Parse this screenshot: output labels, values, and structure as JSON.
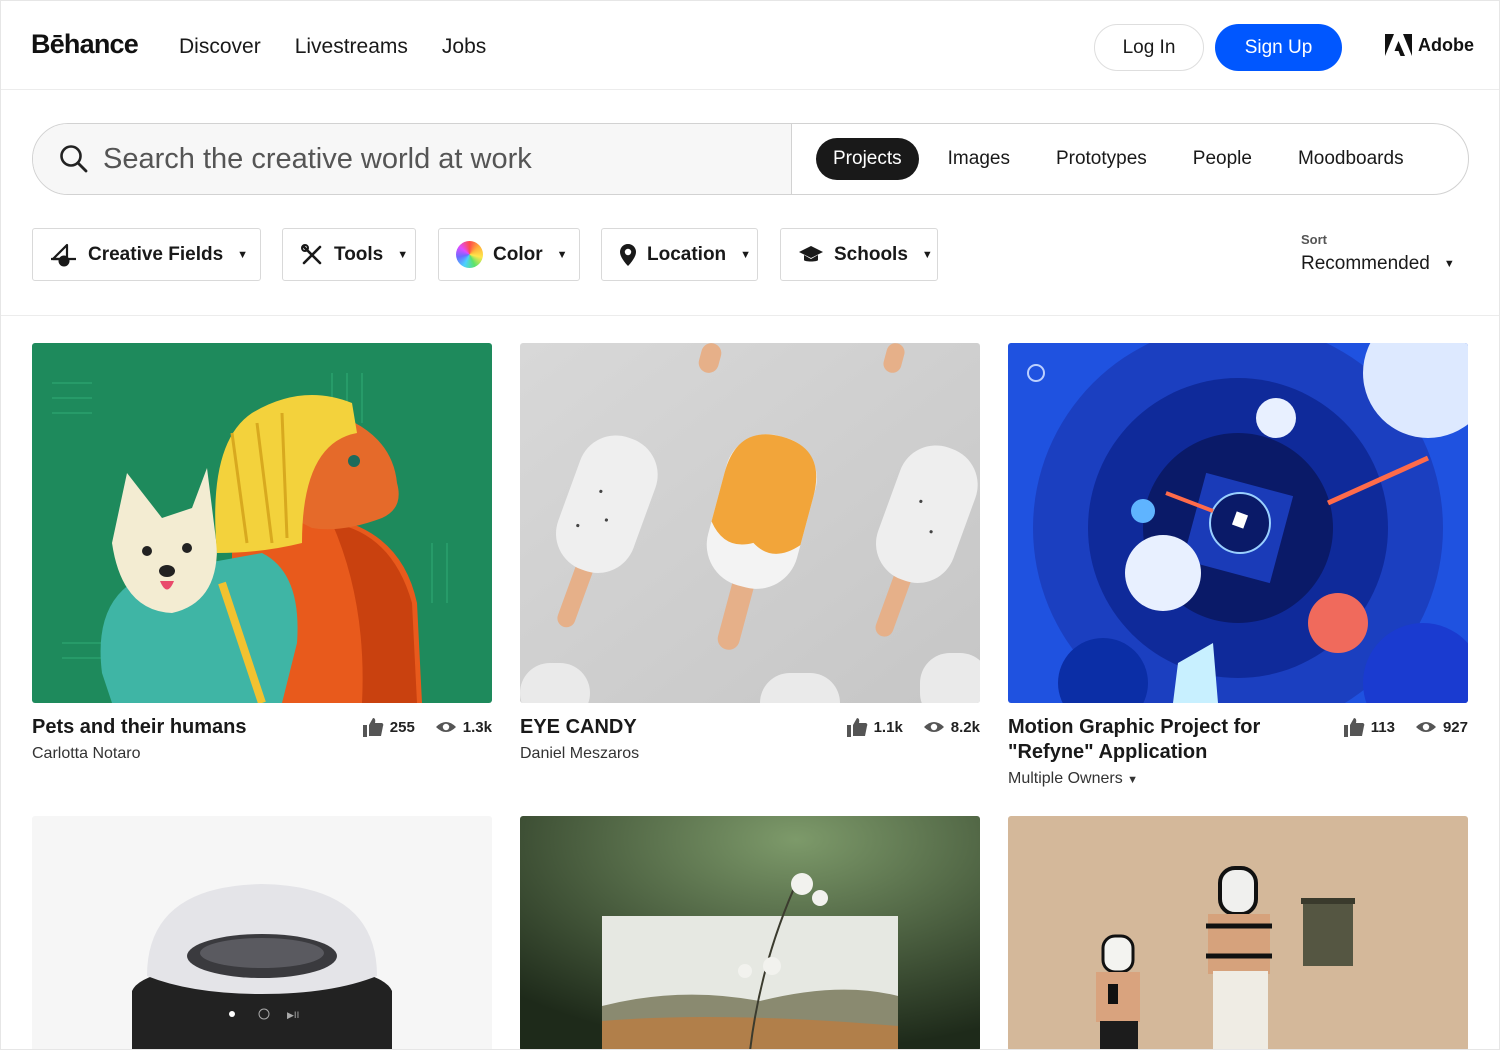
{
  "header": {
    "logo": "Bēhance",
    "nav": [
      "Discover",
      "Livestreams",
      "Jobs"
    ],
    "login": "Log In",
    "signup": "Sign Up",
    "adobe": "Adobe"
  },
  "search": {
    "placeholder": "Search the creative world at work",
    "tabs": [
      "Projects",
      "Images",
      "Prototypes",
      "People",
      "Moodboards"
    ]
  },
  "filters": [
    "Creative Fields",
    "Tools",
    "Color",
    "Location",
    "Schools"
  ],
  "sort": {
    "label": "Sort",
    "value": "Recommended"
  },
  "colors": {
    "brand_blue": "#0057ff",
    "active_tab": "#191919"
  },
  "projects": [
    {
      "title": "Pets and their humans",
      "owner": "Carlotta Notaro",
      "likes": "255",
      "views": "1.3k"
    },
    {
      "title": "EYE CANDY",
      "owner": "Daniel Meszaros",
      "likes": "1.1k",
      "views": "8.2k"
    },
    {
      "title": "Motion Graphic Project for \"Refyne\" Application",
      "owner": "Multiple Owners",
      "likes": "113",
      "views": "927"
    }
  ]
}
